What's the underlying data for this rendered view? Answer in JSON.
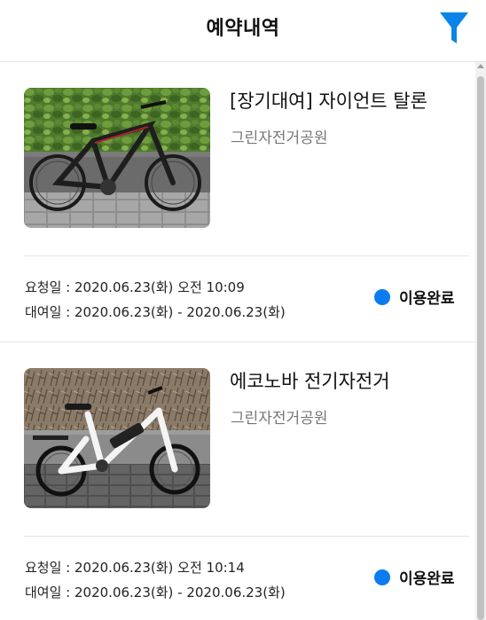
{
  "header": {
    "title": "예약내역",
    "filter_icon": "filter-icon",
    "accent_color": "#0a84e8"
  },
  "reservations": [
    {
      "name": "[장기대여] 자이언트 탈론",
      "location": "그린자전거공원",
      "request_label": "요청일 : ",
      "request_value": "2020.06.23(화) 오전 10:09",
      "rental_label": "대여일 : ",
      "rental_value": "2020.06.23(화) - 2020.06.23(화)",
      "status": "이용완료",
      "status_color": "#0a7cf0",
      "image": "black-mountain-bike-photo"
    },
    {
      "name": "에코노바 전기자전거",
      "location": "그린자전거공원",
      "request_label": "요청일 : ",
      "request_value": "2020.06.23(화) 오전 10:14",
      "rental_label": "대여일 : ",
      "rental_value": "2020.06.23(화) - 2020.06.23(화)",
      "status": "이용완료",
      "status_color": "#0a7cf0",
      "image": "white-electric-bike-photo"
    }
  ]
}
